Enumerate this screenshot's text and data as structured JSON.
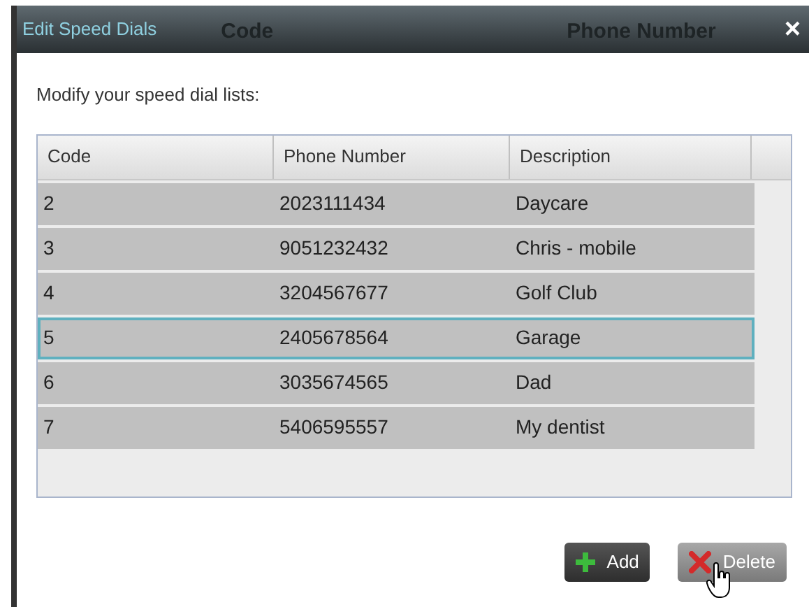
{
  "background_window": {
    "columns": [
      "Code",
      "Phone Number"
    ]
  },
  "window": {
    "title": "Edit Speed Dials",
    "close": "×"
  },
  "instruction": "Modify your speed dial lists:",
  "table": {
    "columns": [
      "Code",
      "Phone Number",
      "Description"
    ],
    "rows": [
      {
        "cells": [
          "2",
          "2023111434",
          "Daycare"
        ],
        "selected": false
      },
      {
        "cells": [
          "3",
          "9051232432",
          "Chris - mobile"
        ],
        "selected": false
      },
      {
        "cells": [
          "4",
          "3204567677",
          "Golf Club"
        ],
        "selected": false
      },
      {
        "cells": [
          "5",
          "2405678564",
          "Garage"
        ],
        "selected": true
      },
      {
        "cells": [
          "6",
          "3035674565",
          "Dad"
        ],
        "selected": false
      },
      {
        "cells": [
          "7",
          "5406595557",
          "My dentist"
        ],
        "selected": false
      }
    ]
  },
  "buttons": [
    {
      "kind": "add",
      "label": "Add"
    },
    {
      "kind": "delete",
      "label": "Delete"
    }
  ]
}
